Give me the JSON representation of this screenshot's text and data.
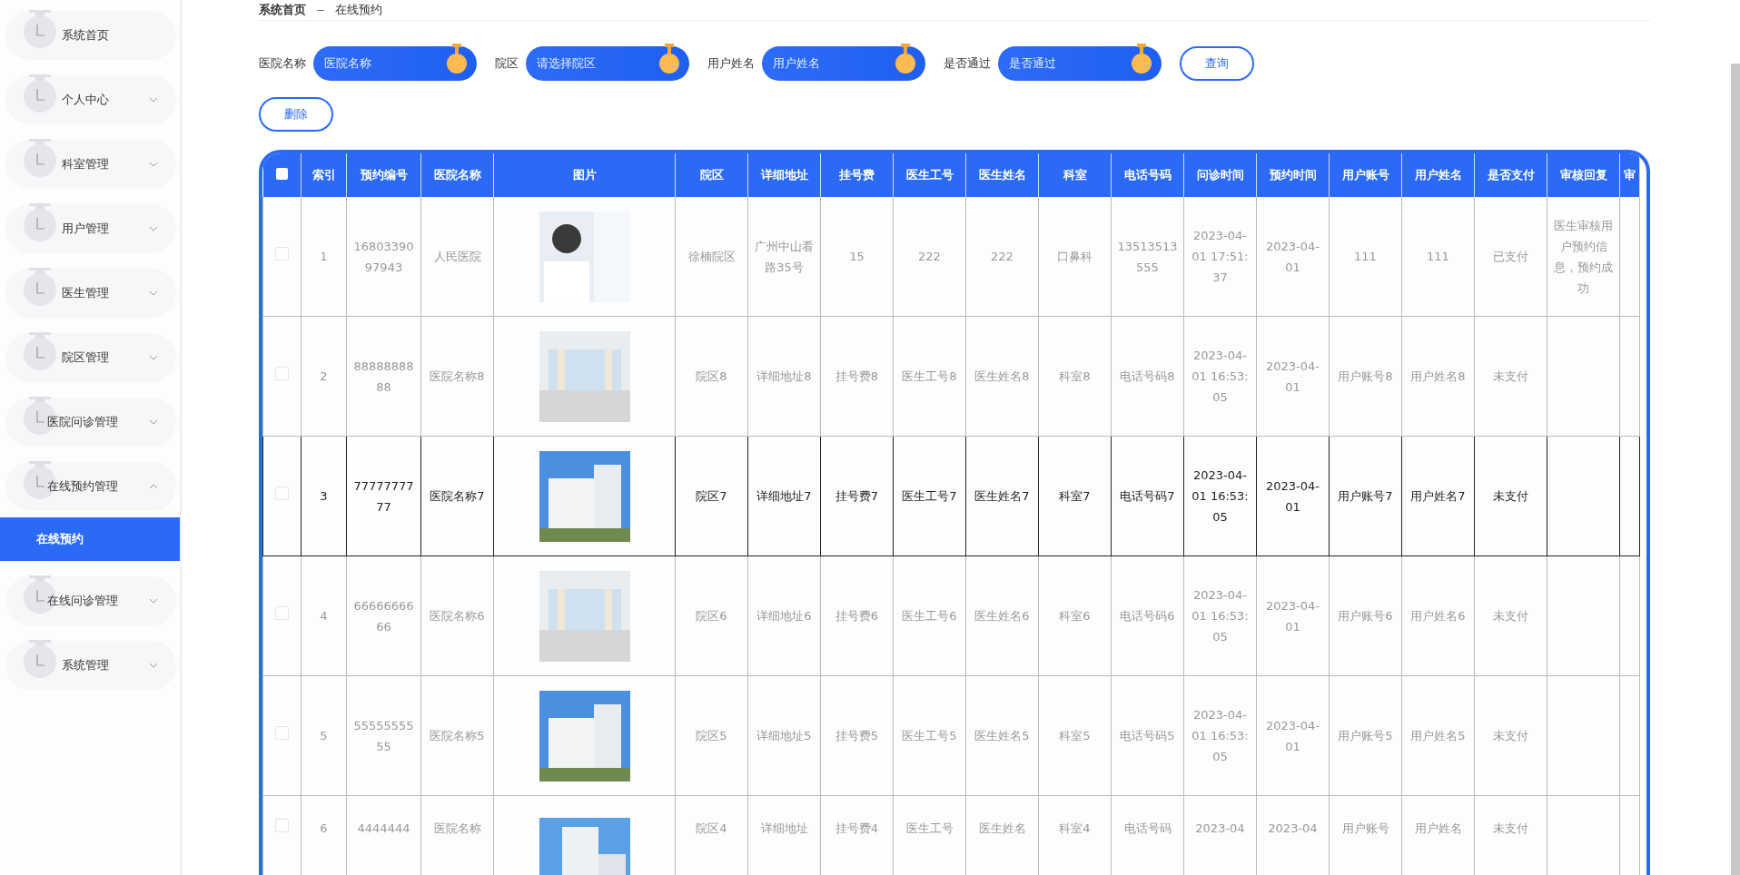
{
  "breadcrumb": [
    "系统首页",
    "在线预约"
  ],
  "sidebar": {
    "items": [
      {
        "label": "系统首页",
        "expandable": false
      },
      {
        "label": "个人中心",
        "expandable": true,
        "expanded": false
      },
      {
        "label": "科室管理",
        "expandable": true,
        "expanded": false
      },
      {
        "label": "用户管理",
        "expandable": true,
        "expanded": false
      },
      {
        "label": "医生管理",
        "expandable": true,
        "expanded": false
      },
      {
        "label": "院区管理",
        "expandable": true,
        "expanded": false
      },
      {
        "label": "医院问诊管理",
        "expandable": true,
        "expanded": false
      },
      {
        "label": "在线预约管理",
        "expandable": true,
        "expanded": true,
        "children": [
          {
            "label": "在线预约",
            "selected": true
          }
        ]
      },
      {
        "label": "在线问诊管理",
        "expandable": true,
        "expanded": false
      },
      {
        "label": "系统管理",
        "expandable": true,
        "expanded": false
      }
    ]
  },
  "filters": [
    {
      "label": "医院名称",
      "placeholder": "医院名称",
      "kind": "input"
    },
    {
      "label": "院区",
      "placeholder": "请选择院区",
      "kind": "select"
    },
    {
      "label": "用户姓名",
      "placeholder": "用户姓名",
      "kind": "input"
    },
    {
      "label": "是否通过",
      "placeholder": "是否通过",
      "kind": "select"
    }
  ],
  "search_button": "查询",
  "delete_button": "删除",
  "table": {
    "select_all_checked": false,
    "columns": [
      "索引",
      "预约编号",
      "医院名称",
      "图片",
      "院区",
      "详细地址",
      "挂号费",
      "医生工号",
      "医生姓名",
      "科室",
      "电话号码",
      "问诊时间",
      "预约时间",
      "用户账号",
      "用户姓名",
      "是否支付",
      "审核回复",
      "审"
    ],
    "rows": [
      {
        "checked": false,
        "highlighted": false,
        "photo": {
          "kind": "person"
        },
        "cells": [
          "1",
          "1680339097943",
          "人民医院",
          "",
          "徐楠院区",
          "广州中山看路35号",
          "15",
          "222",
          "222",
          "口鼻科",
          "13513513555",
          "2023-04-01 17:51:37",
          "2023-04-01",
          "111",
          "111",
          "已支付",
          "医生审核用户预约信息，预约成功",
          ""
        ]
      },
      {
        "checked": false,
        "highlighted": false,
        "photo": {
          "kind": "interior"
        },
        "cells": [
          "2",
          "8888888888",
          "医院名称8",
          "",
          "院区8",
          "详细地址8",
          "挂号费8",
          "医生工号8",
          "医生姓名8",
          "科室8",
          "电话号码8",
          "2023-04-01 16:53:05",
          "2023-04-01",
          "用户账号8",
          "用户姓名8",
          "未支付",
          "",
          ""
        ]
      },
      {
        "checked": false,
        "highlighted": true,
        "photo": {
          "kind": "building"
        },
        "cells": [
          "3",
          "7777777777",
          "医院名称7",
          "",
          "院区7",
          "详细地址7",
          "挂号费7",
          "医生工号7",
          "医生姓名7",
          "科室7",
          "电话号码7",
          "2023-04-01 16:53:05",
          "2023-04-01",
          "用户账号7",
          "用户姓名7",
          "未支付",
          "",
          ""
        ]
      },
      {
        "checked": false,
        "highlighted": false,
        "photo": {
          "kind": "interior"
        },
        "cells": [
          "4",
          "6666666666",
          "医院名称6",
          "",
          "院区6",
          "详细地址6",
          "挂号费6",
          "医生工号6",
          "医生姓名6",
          "科室6",
          "电话号码6",
          "2023-04-01 16:53:05",
          "2023-04-01",
          "用户账号6",
          "用户姓名6",
          "未支付",
          "",
          ""
        ]
      },
      {
        "checked": false,
        "highlighted": false,
        "photo": {
          "kind": "building"
        },
        "cells": [
          "5",
          "5555555555",
          "医院名称5",
          "",
          "院区5",
          "详细地址5",
          "挂号费5",
          "医生工号5",
          "医生姓名5",
          "科室5",
          "电话号码5",
          "2023-04-01 16:53:05",
          "2023-04-01",
          "用户账号5",
          "用户姓名5",
          "未支付",
          "",
          ""
        ]
      },
      {
        "checked": false,
        "highlighted": false,
        "photo": {
          "kind": "tower"
        },
        "cells": [
          "6",
          "4444444",
          "医院名称",
          "",
          "院区4",
          "详细地址",
          "挂号费4",
          "医生工号",
          "医生姓名",
          "科室4",
          "电话号码",
          "2023-04",
          "2023-04",
          "用户账号",
          "用户姓名",
          "未支付",
          "",
          ""
        ]
      }
    ]
  }
}
